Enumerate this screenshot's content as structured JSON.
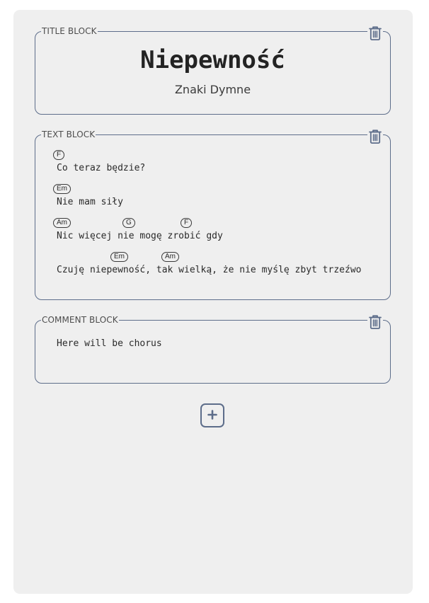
{
  "title_block": {
    "legend": "TITLE BLOCK",
    "song_title": "Niepewność",
    "author": "Znaki Dymne"
  },
  "text_block": {
    "legend": "TEXT BLOCK",
    "lines": [
      {
        "lyric": "Co teraz będzie?",
        "chords": [
          "F"
        ]
      },
      {
        "lyric": "Nie mam siły",
        "chords": [
          "Em"
        ]
      },
      {
        "lyric": "Nic więcej nie mogę zrobić gdy",
        "chords": [
          "Am",
          "G",
          "F"
        ]
      },
      {
        "lyric": "Czuję niepewność, tak wielką, że nie myślę zbyt trzeźwo",
        "chords": [
          "Em",
          "Am"
        ]
      }
    ]
  },
  "comment_block": {
    "legend": "COMMENT BLOCK",
    "text": "Here will be chorus"
  },
  "icons": {
    "delete": "trash-icon",
    "add": "plus-icon"
  },
  "colors": {
    "accent": "#5d6d8a",
    "panel": "#efefef"
  }
}
